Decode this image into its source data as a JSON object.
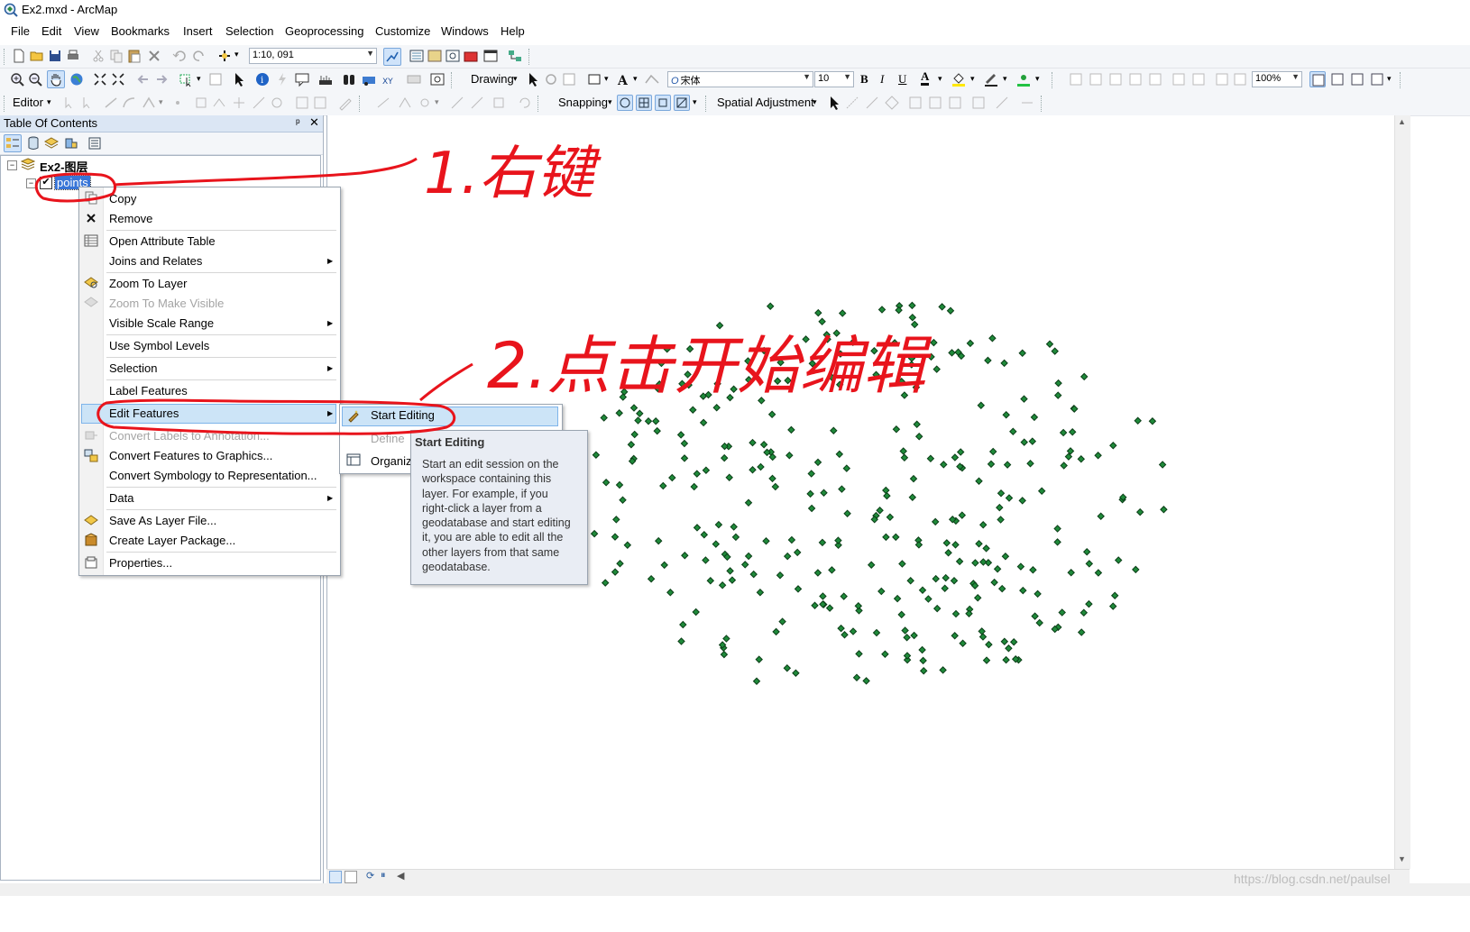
{
  "window": {
    "title": "Ex2.mxd - ArcMap"
  },
  "menubar": [
    "File",
    "Edit",
    "View",
    "Bookmarks",
    "Insert",
    "Selection",
    "Geoprocessing",
    "Customize",
    "Windows",
    "Help"
  ],
  "toolbar": {
    "scale": "1:10, 091",
    "drawing_label": "Drawing",
    "font_name": "宋体",
    "font_size": "10",
    "bold": "B",
    "italic": "I",
    "underline": "U",
    "font_color_glyph": "A",
    "zoom_percent": "100%",
    "editor_label": "Editor",
    "snapping_label": "Snapping",
    "spatial_adjustment_label": "Spatial Adjustment"
  },
  "toc": {
    "title": "Table Of Contents",
    "pin": "ᵖ",
    "close": "✕",
    "data_frame": "Ex2-图层",
    "layer": "points"
  },
  "context_menu": {
    "items": [
      {
        "label": "Copy",
        "disabled": false
      },
      {
        "label": "Remove",
        "disabled": false
      },
      {
        "label": "Open Attribute Table",
        "disabled": false
      },
      {
        "label": "Joins and Relates",
        "disabled": false,
        "submenu": true
      },
      {
        "label": "Zoom To Layer",
        "disabled": false
      },
      {
        "label": "Zoom To Make Visible",
        "disabled": true
      },
      {
        "label": "Visible Scale Range",
        "disabled": false,
        "submenu": true
      },
      {
        "label": "Use Symbol Levels",
        "disabled": false
      },
      {
        "label": "Selection",
        "disabled": false,
        "submenu": true
      },
      {
        "label": "Label Features",
        "disabled": false
      },
      {
        "label": "Edit Features",
        "disabled": false,
        "submenu": true,
        "highlighted": true
      },
      {
        "label": "Convert Labels to Annotation...",
        "disabled": true
      },
      {
        "label": "Convert Features to Graphics...",
        "disabled": false
      },
      {
        "label": "Convert Symbology to Representation...",
        "disabled": false
      },
      {
        "label": "Data",
        "disabled": false,
        "submenu": true
      },
      {
        "label": "Save As Layer File...",
        "disabled": false
      },
      {
        "label": "Create Layer Package...",
        "disabled": false
      },
      {
        "label": "Properties...",
        "disabled": false
      }
    ]
  },
  "submenu": {
    "start_editing": "Start Editing",
    "define": "Define",
    "organize": "Organiz"
  },
  "tooltip": {
    "title": "Start Editing",
    "body": "Start an edit session on the\nworkspace containing this\nlayer. For example, if you\nright-click a layer from a\ngeodatabase and start editing\nit, you are able to edit all the\nother layers from that same\ngeodatabase."
  },
  "annotations": {
    "step1": "1.右键",
    "step2": "2.点击开始编辑",
    "color": "#e8141c"
  },
  "map": {
    "point_color": "#1f8a3a",
    "point_outline": "#0b3d17"
  },
  "watermark": "https://blog.csdn.net/paulsel"
}
